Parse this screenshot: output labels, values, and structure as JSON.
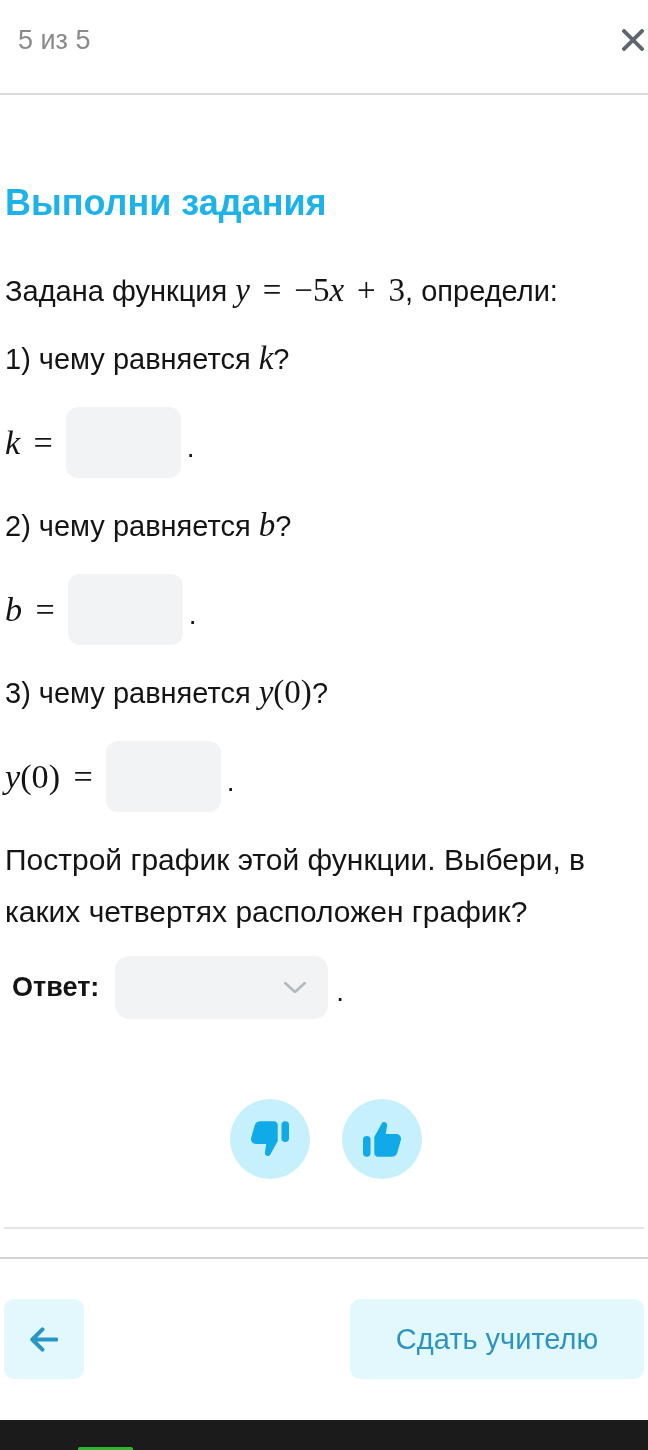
{
  "header": {
    "progress": "5 из 5"
  },
  "title": "Выполни задания",
  "intro": [
    {
      "kind": "text",
      "text": "Задана функция "
    },
    {
      "kind": "var",
      "text": "y"
    },
    {
      "kind": "math",
      "text": " = −5"
    },
    {
      "kind": "var",
      "text": "x"
    },
    {
      "kind": "math",
      "text": " + 3"
    },
    {
      "kind": "text",
      "text": ", определи:"
    }
  ],
  "questions": [
    {
      "prompt": [
        {
          "kind": "text",
          "text": "1) чему равняется "
        },
        {
          "kind": "var",
          "text": "k"
        },
        {
          "kind": "text",
          "text": "?"
        }
      ],
      "answer": {
        "label": [
          {
            "kind": "var",
            "text": "k"
          },
          {
            "kind": "math",
            "text": " ="
          }
        ],
        "end": "."
      }
    },
    {
      "prompt": [
        {
          "kind": "text",
          "text": "2) чему равняется "
        },
        {
          "kind": "var",
          "text": "b"
        },
        {
          "kind": "text",
          "text": "?"
        }
      ],
      "answer": {
        "label": [
          {
            "kind": "var",
            "text": "b"
          },
          {
            "kind": "math",
            "text": " ="
          }
        ],
        "end": "."
      }
    },
    {
      "prompt": [
        {
          "kind": "text",
          "text": "3) чему равняется "
        },
        {
          "kind": "var",
          "text": "y"
        },
        {
          "kind": "math",
          "text": "(0)"
        },
        {
          "kind": "text",
          "text": "?"
        }
      ],
      "answer": {
        "label": [
          {
            "kind": "var",
            "text": "y"
          },
          {
            "kind": "math",
            "text": "(0) ="
          }
        ],
        "end": "."
      }
    }
  ],
  "task": "Построй график этой функции. Выбери, в каких четвертях расположен график?",
  "answer_select": {
    "label": "Ответ:",
    "end": "."
  },
  "footer": {
    "submit": "Сдать учителю"
  }
}
